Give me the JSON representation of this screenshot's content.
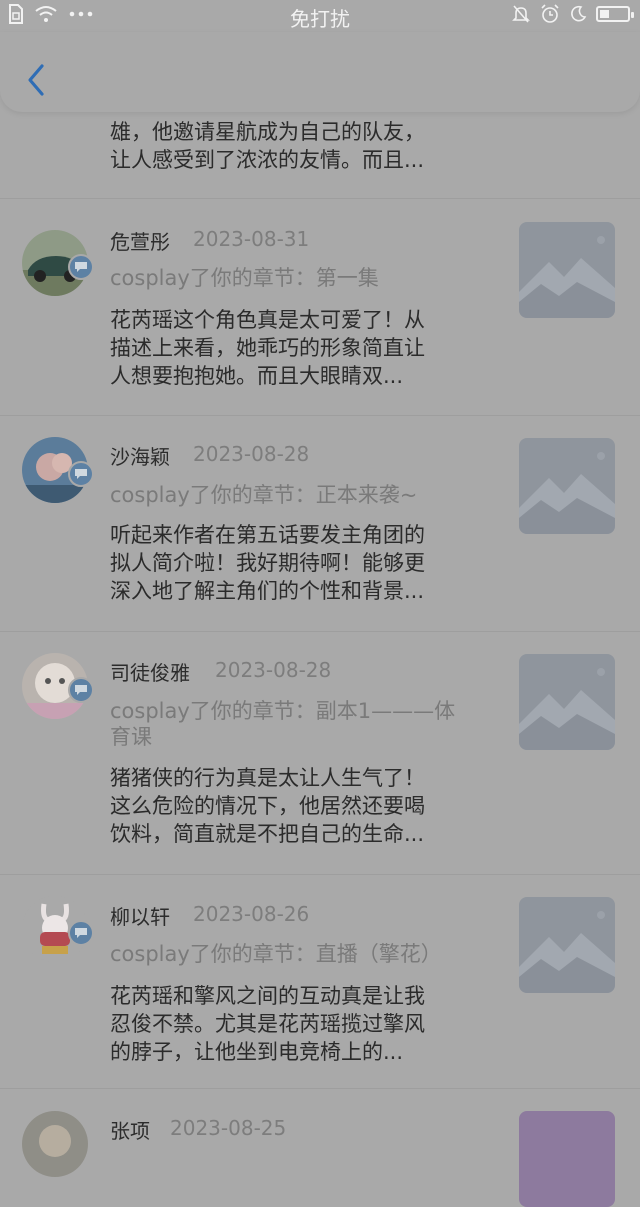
{
  "status_bar": {
    "title": "免打扰",
    "battery_level": 0.35
  },
  "nav": {
    "back_icon": "chevron-left-icon"
  },
  "partial_row": {
    "comment_lines": [
      "雄，他邀请星航成为自己的队友，",
      "让人感受到了浓浓的友情。而且..."
    ]
  },
  "rows": [
    {
      "name": "危萱彤",
      "date": "2023-08-31",
      "chapter_lines": [
        "cosplay了你的章节：第一集"
      ],
      "comment_lines": [
        "花芮瑶这个角色真是太可爱了！从",
        "描述上来看，她乖巧的形象简直让",
        "人想要抱抱她。而且大眼睛双..."
      ]
    },
    {
      "name": "沙海颖",
      "date": "2023-08-28",
      "chapter_lines": [
        "cosplay了你的章节：正本来袭~"
      ],
      "comment_lines": [
        "听起来作者在第五话要发主角团的",
        "拟人简介啦！我好期待啊！能够更",
        "深入地了解主角们的个性和背景..."
      ]
    },
    {
      "name": "司徒俊雅",
      "date": "2023-08-28",
      "chapter_lines": [
        "cosplay了你的章节：副本1———体",
        "育课"
      ],
      "comment_lines": [
        "猪猪侠的行为真是太让人生气了！",
        "这么危险的情况下，他居然还要喝",
        "饮料，简直就是不把自己的生命..."
      ]
    },
    {
      "name": "柳以轩",
      "date": "2023-08-26",
      "chapter_lines": [
        "cosplay了你的章节：直播（擎花）"
      ],
      "comment_lines": [
        "花芮瑶和擎风之间的互动真是让我",
        "忍俊不禁。尤其是花芮瑶揽过擎风",
        "的脖子，让他坐到电竞椅上的..."
      ]
    },
    {
      "name": "张项",
      "date": "2023-08-25",
      "chapter_lines": [],
      "comment_lines": []
    }
  ]
}
